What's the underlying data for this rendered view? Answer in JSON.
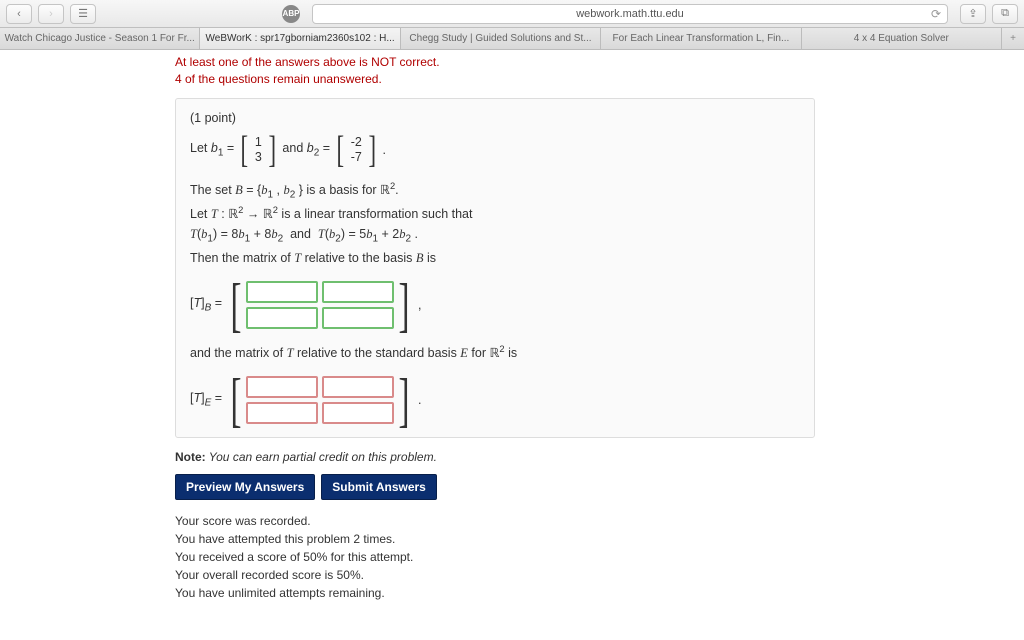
{
  "browser": {
    "url": "webwork.math.ttu.edu",
    "tabs": [
      "Watch Chicago Justice - Season 1 For Fr...",
      "WeBWorK : spr17gborniam2360s102 : H...",
      "Chegg Study | Guided Solutions and St...",
      "For Each Linear Transformation L, Fin...",
      "4 x 4 Equation Solver"
    ],
    "active_tab": 1,
    "abp_label": "ABP"
  },
  "feedback": {
    "line1": "At least one of the answers above is NOT correct.",
    "line2": "4 of the questions remain unanswered."
  },
  "problem": {
    "points_label": "(1 point)",
    "let_b1": "Let b₁ =",
    "b1": [
      "1",
      "3"
    ],
    "and_b2": "and b₂ =",
    "b2": [
      "-2",
      "-7"
    ],
    "period": ".",
    "para1_l1": "The set B = {b₁ , b₂ } is a basis for ℝ².",
    "para1_l2": "Let T : ℝ² → ℝ² is a linear transformation such that",
    "para1_l3": "T(b₁) = 8b₁ + 8b₂  and  T(b₂) = 5b₁ + 2b₂ .",
    "para1_l4": "Then the matrix of T relative to the basis B is",
    "TB_label": "[T]_B =",
    "comma": ",",
    "para2": "and the matrix of T relative to the standard basis E for ℝ² is",
    "TE_label": "[T]_E =",
    "period2": "."
  },
  "note": {
    "prefix": "Note:",
    "text": " You can earn partial credit on this problem."
  },
  "buttons": {
    "preview": "Preview My Answers",
    "submit": "Submit Answers"
  },
  "status": [
    "Your score was recorded.",
    "You have attempted this problem 2 times.",
    "You received a score of 50% for this attempt.",
    "Your overall recorded score is 50%.",
    "You have unlimited attempts remaining."
  ]
}
